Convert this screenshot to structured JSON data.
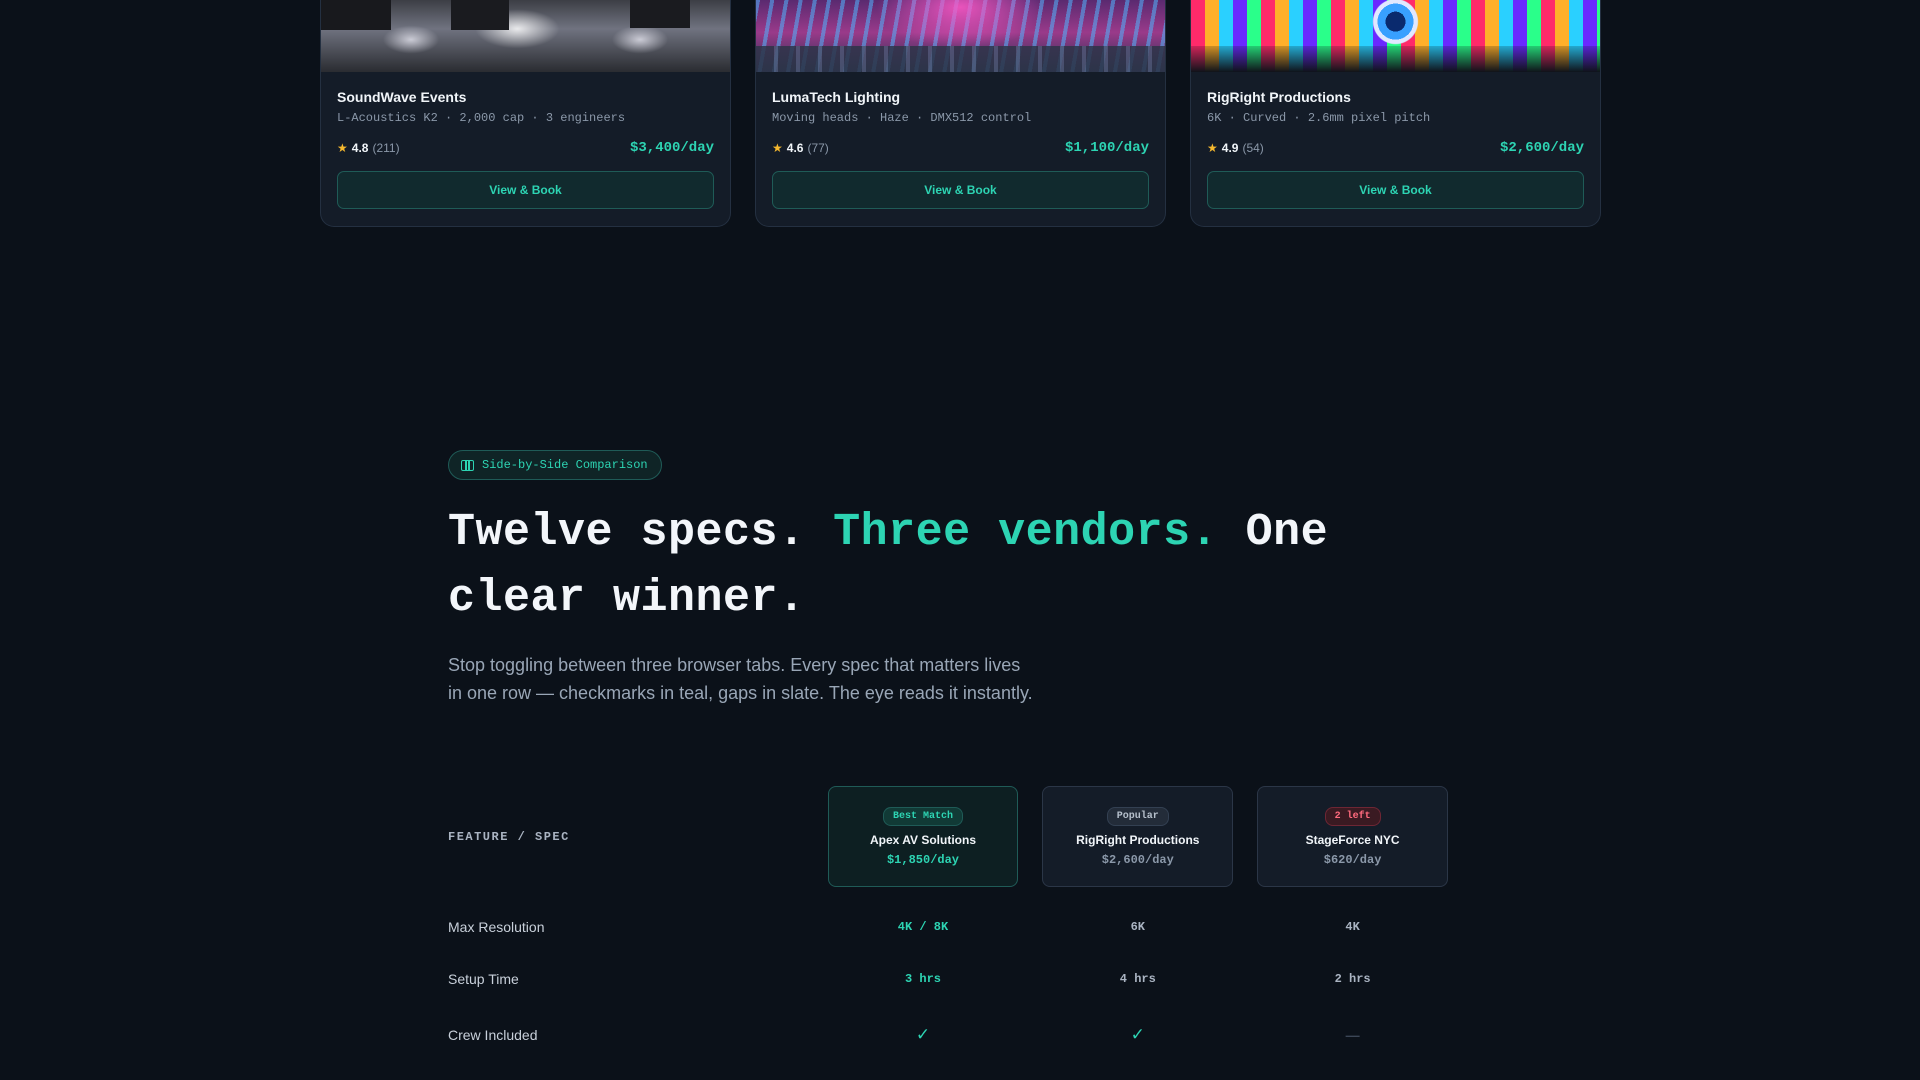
{
  "vendor_cards": [
    {
      "name": "SoundWave Events",
      "specs": "L-Acoustics K2 · 2,000 cap · 3 engineers",
      "rating": "4.8",
      "reviews": "(211)",
      "price": "$3,400/day",
      "button": "View & Book"
    },
    {
      "name": "LumaTech Lighting",
      "specs": "Moving heads · Haze · DMX512 control",
      "rating": "4.6",
      "reviews": "(77)",
      "price": "$1,100/day",
      "button": "View & Book"
    },
    {
      "name": "RigRight Productions",
      "specs": "6K · Curved · 2.6mm pixel pitch",
      "rating": "4.9",
      "reviews": "(54)",
      "price": "$2,600/day",
      "button": "View & Book"
    }
  ],
  "comparison": {
    "eyebrow": "Side-by-Side Comparison",
    "headline": {
      "part1": "Twelve specs. ",
      "accent": "Three vendors.",
      "part2": " One clear winner."
    },
    "lead": "Stop toggling between three browser tabs. Every spec that matters lives in one row — checkmarks in teal, gaps in slate. The eye reads it instantly.",
    "feature_header": "FEATURE / SPEC",
    "vendors": [
      {
        "badge": "Best Match",
        "name": "Apex AV Solutions",
        "price": "$1,850/day"
      },
      {
        "badge": "Popular",
        "name": "RigRight Productions",
        "price": "$2,600/day"
      },
      {
        "badge": "2 left",
        "name": "StageForce NYC",
        "price": "$620/day"
      }
    ],
    "rows": [
      {
        "label": "Max Resolution",
        "values": [
          "4K / 8K",
          "6K",
          "4K"
        ]
      },
      {
        "label": "Setup Time",
        "values": [
          "3 hrs",
          "4 hrs",
          "2 hrs"
        ]
      },
      {
        "label": "Crew Included",
        "values": [
          "check",
          "check",
          "dash"
        ]
      }
    ]
  },
  "colors": {
    "background": "#0b1119",
    "accent": "#2dd4b3",
    "card": "#141c28",
    "star": "#f5b82e",
    "badge_warning": "#ff6b7e"
  },
  "icons": {
    "rating": "star-icon",
    "eyebrow": "table-icon",
    "yes": "check-icon",
    "no": "dash-icon"
  }
}
